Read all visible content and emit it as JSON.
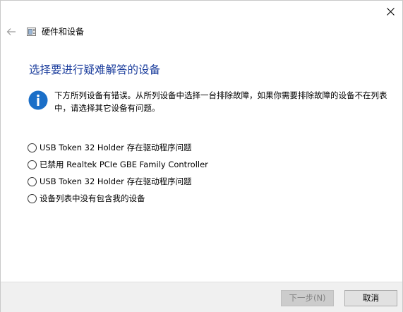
{
  "window": {
    "title": "硬件和设备",
    "close_icon": "close-icon",
    "back_icon": "arrow-left-icon"
  },
  "page": {
    "title": "选择要进行疑难解答的设备",
    "info_icon": "info-icon",
    "info_text": "下方所列设备有错误。从所列设备中选择一台排除故障，如果你需要排除故障的设备不在列表中，请选择其它设备有问题。"
  },
  "options": [
    {
      "label": "USB Token 32 Holder 存在驱动程序问题",
      "selected": false
    },
    {
      "label": "已禁用 Realtek PCIe GBE Family Controller",
      "selected": false
    },
    {
      "label": "USB Token 32 Holder 存在驱动程序问题",
      "selected": false
    },
    {
      "label": "设备列表中没有包含我的设备",
      "selected": false
    }
  ],
  "footer": {
    "next_label": "下一步(N)",
    "next_enabled": false,
    "cancel_label": "取消"
  },
  "colors": {
    "title_blue": "#1a3c9c",
    "info_blue": "#1b6fc8",
    "footer_bg": "#f0f0f0"
  }
}
